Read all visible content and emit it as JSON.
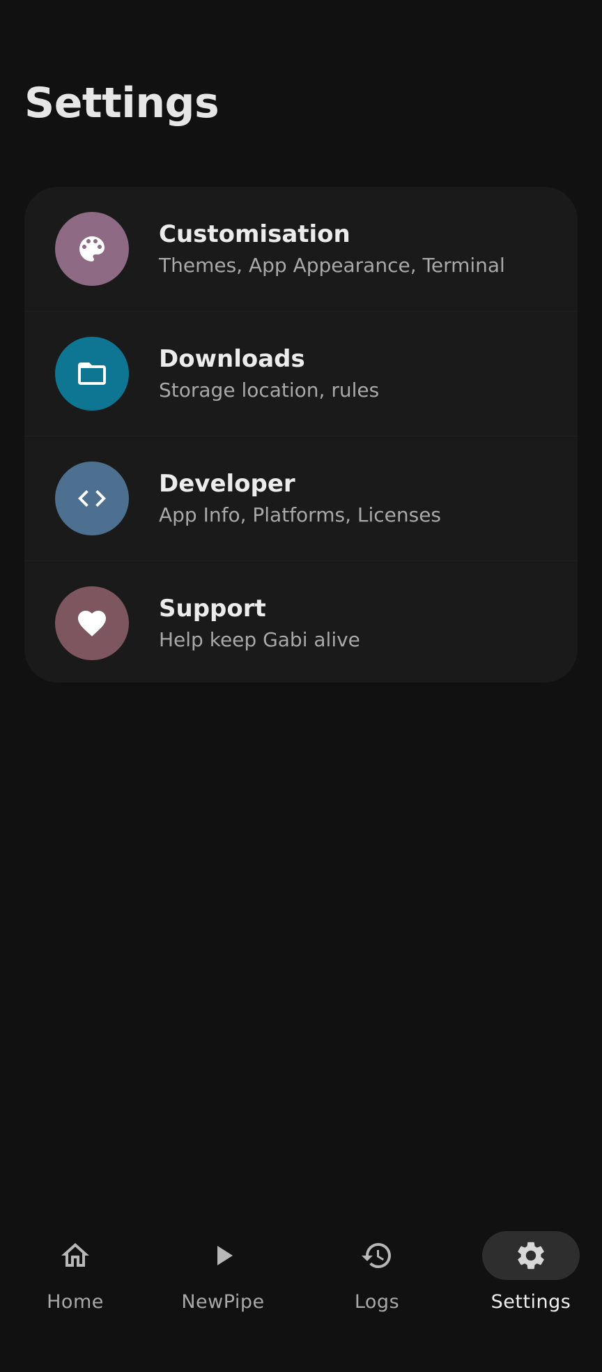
{
  "page": {
    "title": "Settings"
  },
  "settings": {
    "items": [
      {
        "title": "Customisation",
        "subtitle": "Themes, App Appearance, Terminal",
        "icon": "palette-icon",
        "icon_bg": "#8e6a84"
      },
      {
        "title": "Downloads",
        "subtitle": "Storage location, rules",
        "icon": "folder-icon",
        "icon_bg": "#0e7592"
      },
      {
        "title": "Developer",
        "subtitle": "App Info, Platforms, Licenses",
        "icon": "code-icon",
        "icon_bg": "#4d6f90"
      },
      {
        "title": "Support",
        "subtitle": "Help keep Gabi alive",
        "icon": "heart-icon",
        "icon_bg": "#7e5660"
      }
    ]
  },
  "bottom_nav": {
    "items": [
      {
        "label": "Home",
        "icon": "home-icon",
        "active": false
      },
      {
        "label": "NewPipe",
        "icon": "play-icon",
        "active": false
      },
      {
        "label": "Logs",
        "icon": "history-icon",
        "active": false
      },
      {
        "label": "Settings",
        "icon": "gear-icon",
        "active": true
      }
    ]
  },
  "colors": {
    "background": "#111111",
    "card": "#1a1a1a",
    "active_nav_pill": "#2e2e2e",
    "text_primary": "#ececec",
    "text_secondary": "#a9a9a9"
  }
}
